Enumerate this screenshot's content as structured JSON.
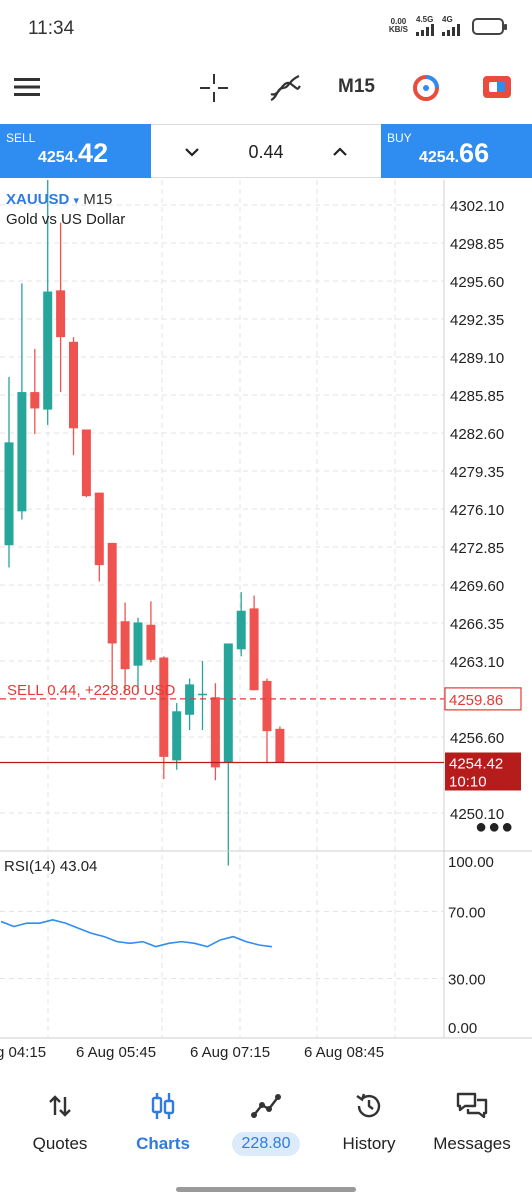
{
  "status": {
    "time": "11:34",
    "net_speed_value": "0.00",
    "net_speed_unit": "KB/S",
    "sig1": "4.5G",
    "sig2": "4G"
  },
  "toolbar": {
    "timeframe": "M15",
    "icons": [
      "menu-icon",
      "crosshair-icon",
      "indicators-icon",
      "timeframe",
      "one-click-trading-icon",
      "trade-icon"
    ]
  },
  "trade": {
    "sell_label": "SELL",
    "sell_price_prefix": "4254.",
    "sell_price_big": "42",
    "buy_label": "BUY",
    "buy_price_prefix": "4254.",
    "buy_price_big": "66",
    "lot": "0.44"
  },
  "chart": {
    "symbol": "XAUUSD",
    "symbol_arrow": "▾",
    "timeframe": "M15",
    "description": "Gold vs US Dollar",
    "price_axis": [
      "4302.10",
      "4298.85",
      "4295.60",
      "4292.35",
      "4289.10",
      "4285.85",
      "4282.60",
      "4279.35",
      "4276.10",
      "4272.85",
      "4269.60",
      "4266.35",
      "4263.10",
      "4256.60",
      "4250.10"
    ],
    "position_text": "SELL 0.44,  +228.80 USD",
    "position_price": "4259.86",
    "current_price": "4254.42",
    "countdown": "10:10",
    "time_axis": [
      "g 04:15",
      "6 Aug 05:45",
      "6 Aug 07:15",
      "6 Aug 08:45"
    ],
    "rsi_label": "RSI(14) 43.04",
    "rsi_axis": [
      "100.00",
      "70.00",
      "30.00",
      "0.00"
    ],
    "colors": {
      "bull": "#26a69a",
      "bear": "#ef5350",
      "position": "#e53935",
      "price_line": "#b71c1c",
      "rsi": "#2f8cf0"
    }
  },
  "chart_data": {
    "type": "candlestick",
    "title": "XAUUSD M15",
    "xlabel": "",
    "ylabel": "",
    "ylim": [
      4247.5,
      4304.5
    ],
    "candles": [
      {
        "o": 4273.0,
        "h": 4287.4,
        "l": 4271.1,
        "c": 4281.8
      },
      {
        "o": 4275.9,
        "h": 4295.4,
        "l": 4275.2,
        "c": 4286.1
      },
      {
        "o": 4286.1,
        "h": 4289.8,
        "l": 4282.5,
        "c": 4284.7
      },
      {
        "o": 4284.6,
        "h": 4306.4,
        "l": 4283.3,
        "c": 4294.7
      },
      {
        "o": 4294.8,
        "h": 4300.6,
        "l": 4286.1,
        "c": 4290.8
      },
      {
        "o": 4290.4,
        "h": 4290.8,
        "l": 4280.7,
        "c": 4283.0
      },
      {
        "o": 4282.9,
        "h": 4282.9,
        "l": 4277.1,
        "c": 4277.2
      },
      {
        "o": 4277.5,
        "h": 4277.5,
        "l": 4269.9,
        "c": 4271.3
      },
      {
        "o": 4273.2,
        "h": 4273.2,
        "l": 4260.9,
        "c": 4264.6
      },
      {
        "o": 4266.5,
        "h": 4268.1,
        "l": 4260.4,
        "c": 4262.4
      },
      {
        "o": 4262.7,
        "h": 4266.8,
        "l": 4260.3,
        "c": 4266.4
      },
      {
        "o": 4266.2,
        "h": 4268.2,
        "l": 4263.0,
        "c": 4263.2
      },
      {
        "o": 4263.4,
        "h": 4263.5,
        "l": 4253.0,
        "c": 4254.9
      },
      {
        "o": 4254.6,
        "h": 4259.5,
        "l": 4253.8,
        "c": 4258.8
      },
      {
        "o": 4258.5,
        "h": 4261.6,
        "l": 4257.2,
        "c": 4261.1
      },
      {
        "o": 4260.2,
        "h": 4263.1,
        "l": 4257.2,
        "c": 4260.3
      },
      {
        "o": 4260.0,
        "h": 4261.2,
        "l": 4252.9,
        "c": 4254.0
      },
      {
        "o": 4254.4,
        "h": 4264.6,
        "l": 4245.6,
        "c": 4264.6
      },
      {
        "o": 4264.1,
        "h": 4269.0,
        "l": 4263.5,
        "c": 4267.4
      },
      {
        "o": 4267.6,
        "h": 4268.7,
        "l": 4260.6,
        "c": 4260.6
      },
      {
        "o": 4261.4,
        "h": 4261.6,
        "l": 4254.4,
        "c": 4257.1
      },
      {
        "o": 4257.3,
        "h": 4257.5,
        "l": 4254.4,
        "c": 4254.4
      }
    ],
    "rsi": [
      64,
      61,
      63,
      63,
      65,
      63,
      60,
      57,
      55,
      52,
      51,
      52,
      49,
      51,
      52,
      51,
      49,
      53,
      55,
      52,
      50,
      49
    ],
    "rsi_ylim": [
      0,
      100
    ]
  },
  "nav": [
    {
      "label": "Quotes",
      "icon": "quotes-icon"
    },
    {
      "label": "Charts",
      "icon": "charts-icon"
    },
    {
      "label": "228.80",
      "icon": "trade-icon"
    },
    {
      "label": "History",
      "icon": "history-icon"
    },
    {
      "label": "Messages",
      "icon": "messages-icon"
    }
  ]
}
